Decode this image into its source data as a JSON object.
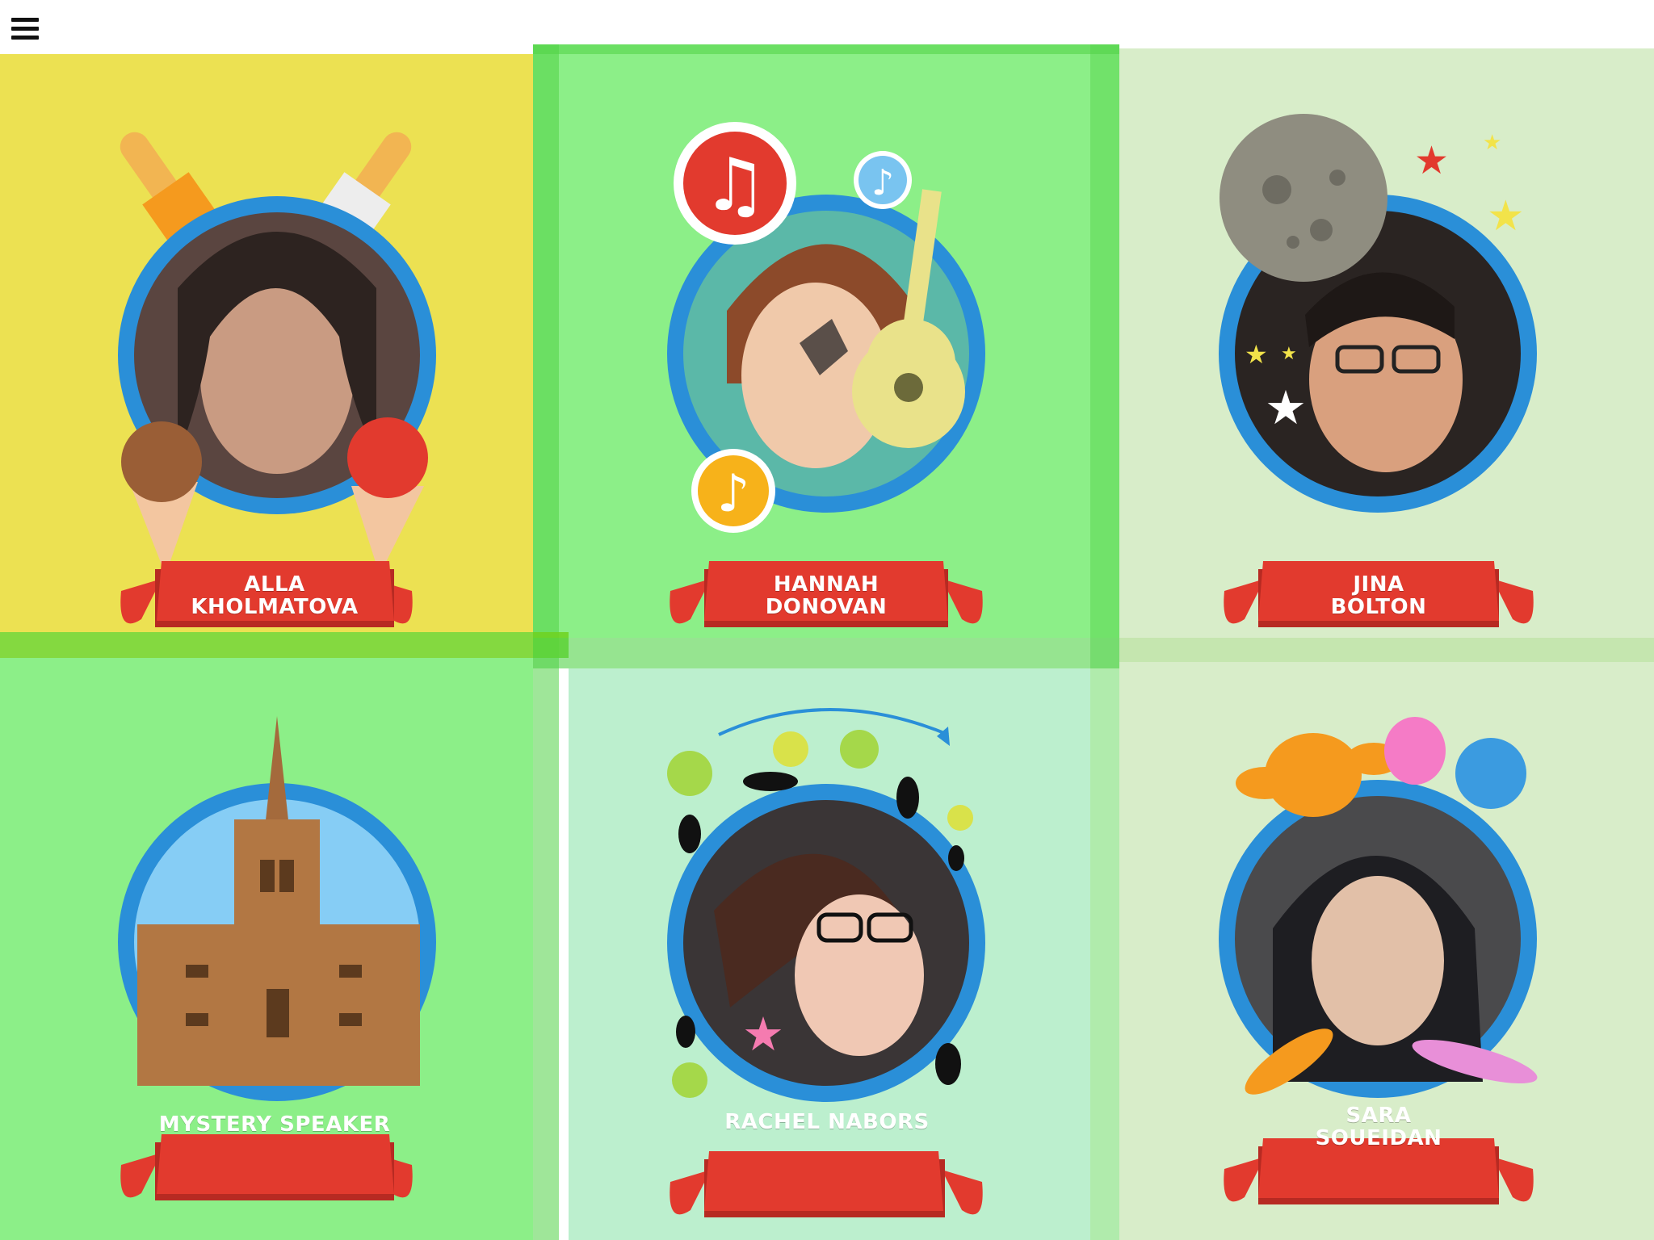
{
  "header": {
    "menu_icon": "hamburger-menu-icon"
  },
  "colors": {
    "yellow": "#ECE152",
    "green": "#8CEF88",
    "light_green": "#D8EDC9",
    "mint": "#BCEFCE",
    "ring_blue": "#2A8FD8",
    "banner_red": "#E23A2E",
    "divider_green": "#5FE05C"
  },
  "speakers": [
    {
      "line1": "ALLA",
      "line2": "KHOLMATOVA",
      "theme": "ice-cream"
    },
    {
      "line1": "HANNAH",
      "line2": "DONOVAN",
      "theme": "music"
    },
    {
      "line1": "JINA",
      "line2": "BOLTON",
      "theme": "space"
    },
    {
      "line1": "MYSTERY SPEAKER",
      "line2": "",
      "theme": "castle"
    },
    {
      "line1": "RACHEL NABORS",
      "line2": "",
      "theme": "cats"
    },
    {
      "line1": "SARA",
      "line2": "SOUEIDAN",
      "theme": "owls"
    }
  ]
}
